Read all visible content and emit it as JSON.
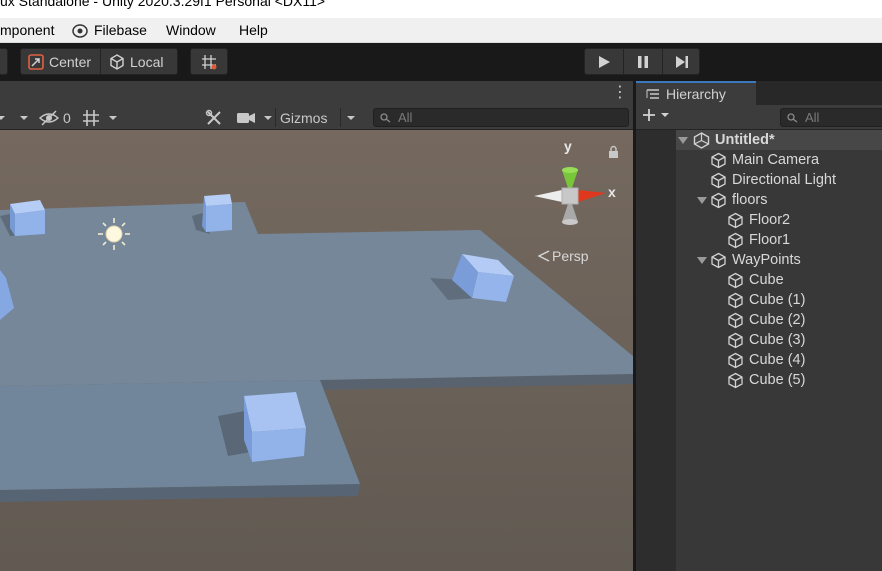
{
  "window": {
    "title": "ux Standalone - Unity 2020.3.29f1 Personal <DX11>"
  },
  "menu": {
    "component": "mponent",
    "filebase": "Filebase",
    "window": "Window",
    "help": "Help"
  },
  "toolbar": {
    "pivot_label": "Center",
    "space_label": "Local"
  },
  "scene_toolbar": {
    "hidden_count": "0",
    "gizmos_label": "Gizmos",
    "search_placeholder": "All"
  },
  "gizmo": {
    "y_label": "y",
    "x_label": "x",
    "projection_label": "Persp"
  },
  "hierarchy": {
    "tab_label": "Hierarchy",
    "search_placeholder": "All",
    "scene_name": "Untitled*",
    "items": [
      {
        "label": "Main Camera"
      },
      {
        "label": "Directional Light"
      },
      {
        "label": "floors"
      },
      {
        "label": "Floor2"
      },
      {
        "label": "Floor1"
      },
      {
        "label": "WayPoints"
      },
      {
        "label": "Cube"
      },
      {
        "label": "Cube (1)"
      },
      {
        "label": "Cube (2)"
      },
      {
        "label": "Cube (3)"
      },
      {
        "label": "Cube (4)"
      },
      {
        "label": "Cube (5)"
      }
    ]
  },
  "colors": {
    "accent": "#3a79bb",
    "cube": "#8fb3ef",
    "floor": "#758694",
    "ground": "#6e655c",
    "gizmo_x": "#e0381e",
    "gizmo_y": "#7ac63a"
  }
}
